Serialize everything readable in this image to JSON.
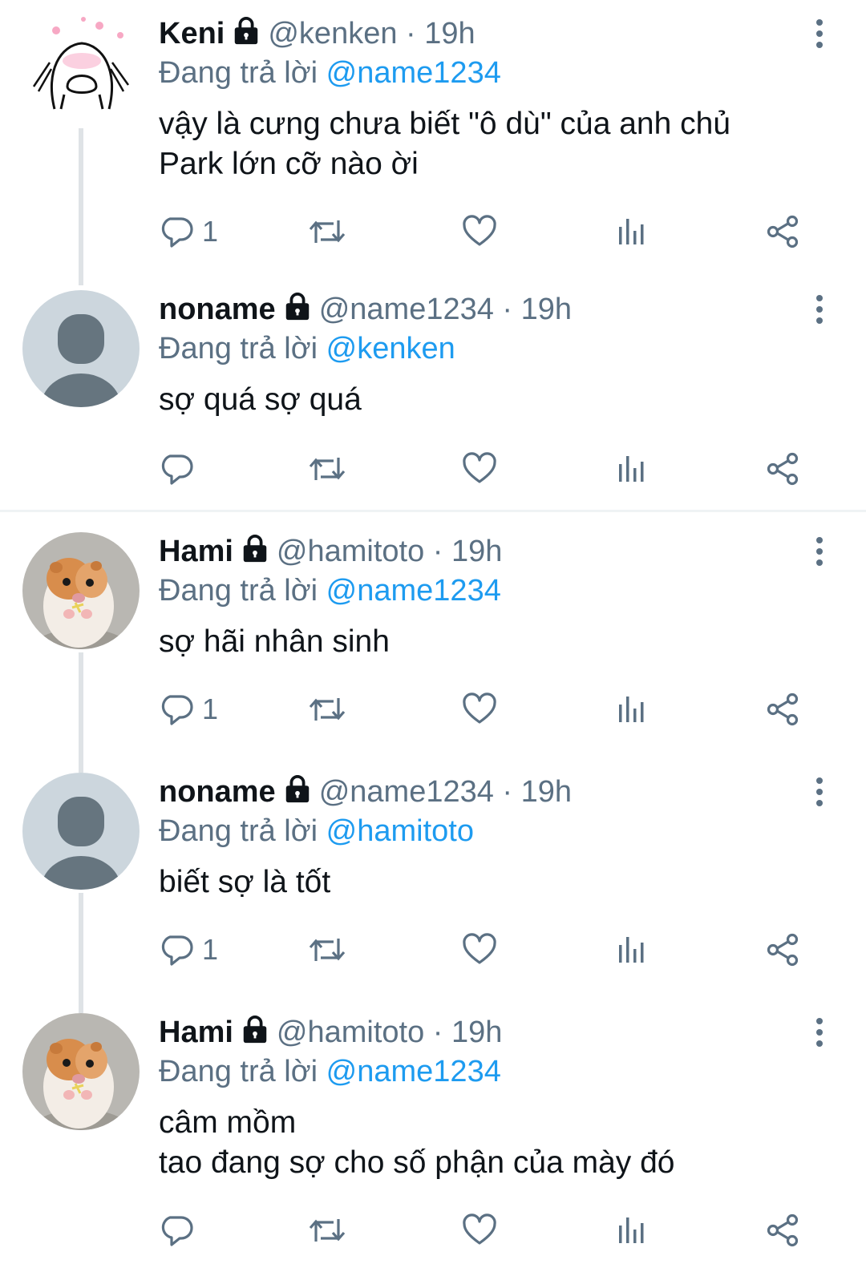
{
  "tweets": [
    {
      "name": "Keni",
      "handle": "@kenken",
      "time": "19h",
      "reply_prefix": "Đang trả lời",
      "reply_to": "@name1234",
      "text": "vậy là cưng chưa biết \"ô dù\" của anh chủ\nPark lớn cỡ nào ời",
      "reply_count": "1",
      "avatar": "doodle"
    },
    {
      "name": "noname",
      "handle": "@name1234",
      "time": "19h",
      "reply_prefix": "Đang trả lời",
      "reply_to": "@kenken",
      "text": "sợ quá sợ quá",
      "reply_count": "",
      "avatar": "default"
    },
    {
      "name": "Hami",
      "handle": "@hamitoto",
      "time": "19h",
      "reply_prefix": "Đang trả lời",
      "reply_to": "@name1234",
      "text": "sợ hãi nhân sinh",
      "reply_count": "1",
      "avatar": "hamster"
    },
    {
      "name": "noname",
      "handle": "@name1234",
      "time": "19h",
      "reply_prefix": "Đang trả lời",
      "reply_to": "@hamitoto",
      "text": "biết sợ là tốt",
      "reply_count": "1",
      "avatar": "default"
    },
    {
      "name": "Hami",
      "handle": "@hamitoto",
      "time": "19h",
      "reply_prefix": "Đang trả lời",
      "reply_to": "@name1234",
      "text": "câm mồm\ntao đang sợ cho số phận của mày đó",
      "reply_count": "",
      "avatar": "hamster"
    }
  ],
  "colors": {
    "accent": "#1d9bf0",
    "muted": "#5b7083",
    "text": "#0f1419",
    "thread": "#dfe3e6"
  },
  "icons": [
    "lock-icon",
    "more-icon",
    "reply-icon",
    "retweet-icon",
    "like-icon",
    "views-icon",
    "share-icon"
  ]
}
